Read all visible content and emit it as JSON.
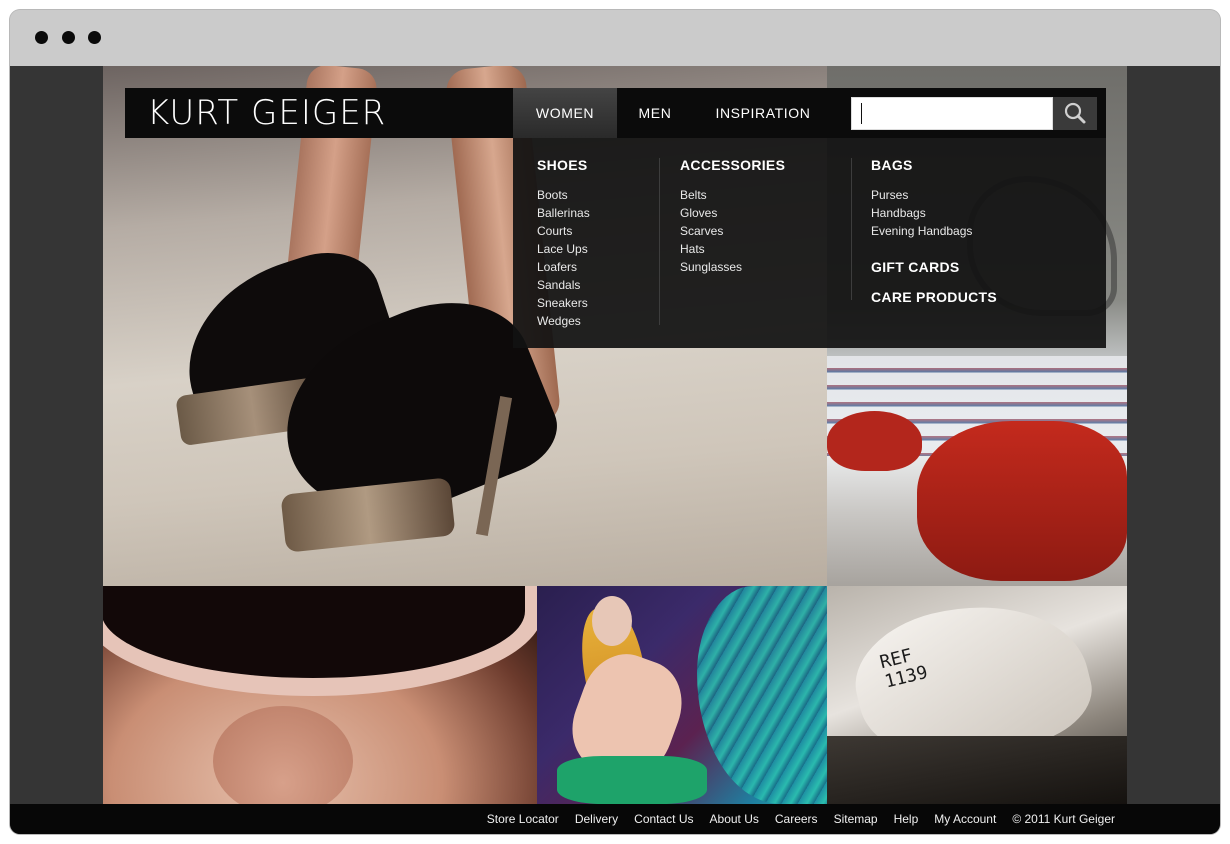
{
  "brand": {
    "logo_text": "KURT GEIGER"
  },
  "nav": {
    "items": [
      {
        "label": "WOMEN",
        "active": true
      },
      {
        "label": "MEN",
        "active": false
      },
      {
        "label": "INSPIRATION",
        "active": false
      }
    ]
  },
  "search": {
    "value": "",
    "placeholder": "",
    "icon": "search-icon"
  },
  "dropdown": {
    "shoes": {
      "heading": "SHOES",
      "links": [
        "Boots",
        "Ballerinas",
        "Courts",
        "Lace Ups",
        "Loafers",
        "Sandals",
        "Sneakers",
        "Wedges"
      ]
    },
    "accessories": {
      "heading": "ACCESSORIES",
      "links": [
        "Belts",
        "Gloves",
        "Scarves",
        "Hats",
        "Sunglasses"
      ]
    },
    "bags": {
      "heading": "BAGS",
      "links": [
        "Purses",
        "Handbags",
        "Evening Handbags"
      ],
      "extra": [
        "GIFT CARDS",
        "CARE PRODUCTS"
      ]
    }
  },
  "tiles": {
    "workshop_label": "REF\n1139"
  },
  "footer": {
    "links": [
      "Store Locator",
      "Delivery",
      "Contact Us",
      "About Us",
      "Careers",
      "Sitemap",
      "Help",
      "My Account"
    ],
    "copyright": "© 2011 Kurt Geiger"
  },
  "colors": {
    "header_bg": "#0b0b0b",
    "dropdown_bg": "#121212",
    "page_bg": "#353535",
    "browser_chrome": "#cbcbcb"
  }
}
